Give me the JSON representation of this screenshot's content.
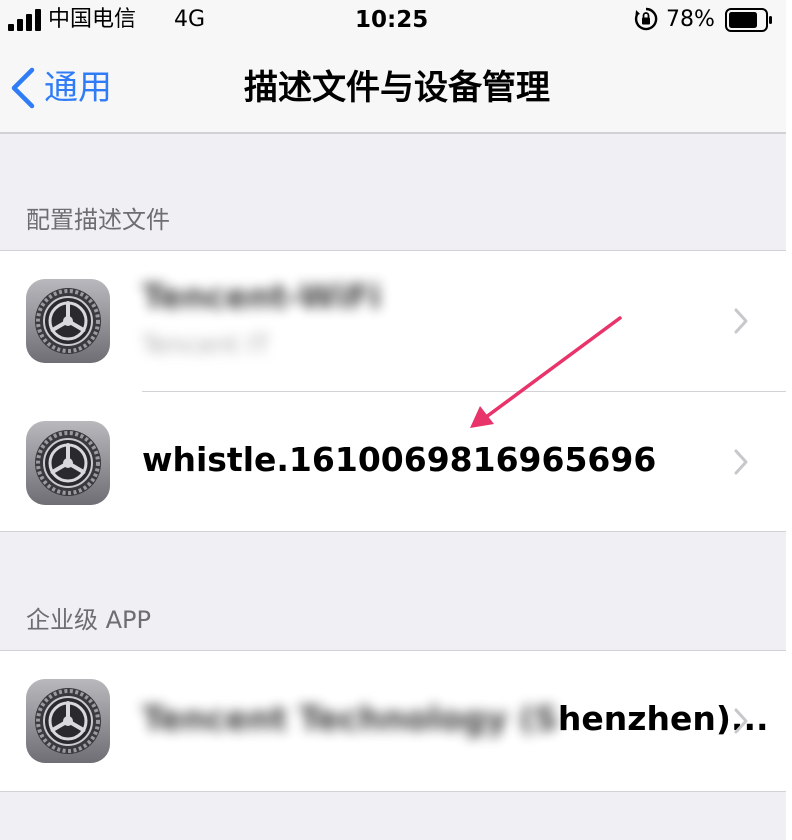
{
  "status_bar": {
    "carrier": "中国电信",
    "network": "4G",
    "time": "10:25",
    "battery_percent": "78%",
    "icons": [
      "signal-icon",
      "orientation-lock-icon",
      "battery-icon"
    ]
  },
  "nav": {
    "back_label": "通用",
    "title": "描述文件与设备管理"
  },
  "sections": [
    {
      "header": "配置描述文件",
      "items": [
        {
          "title": "Tencent-WiFi",
          "subtitle": "Tencent IT",
          "blurred": true
        },
        {
          "title": "whistle.1610069816965696",
          "blurred": false
        }
      ]
    },
    {
      "header": "企业级 APP",
      "items": [
        {
          "title_blurred": "Tencent Technology (S",
          "title_visible": "henzhen)...",
          "blurred": true
        }
      ]
    }
  ],
  "colors": {
    "background": "#efeff4",
    "accent": "#2f7cf6",
    "annotation_arrow": "#e8336b"
  }
}
